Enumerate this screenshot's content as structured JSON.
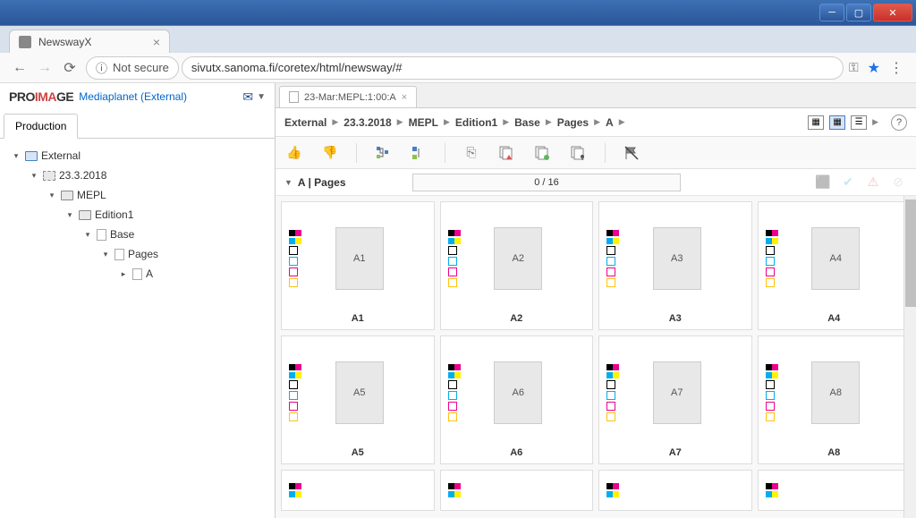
{
  "window": {
    "tab_title": "NewswayX"
  },
  "browser": {
    "not_secure_label": "Not secure",
    "url": "sivutx.sanoma.fi/coretex/html/newsway/#"
  },
  "sidebar": {
    "logo_main": "PRO",
    "logo_accent": "IMA",
    "logo_end": "GE",
    "user": "Mediaplanet (External)",
    "tab": "Production",
    "tree": {
      "root": "External",
      "date": "23.3.2018",
      "pub": "MEPL",
      "edition": "Edition1",
      "base": "Base",
      "pages": "Pages",
      "section": "A"
    }
  },
  "main": {
    "tab_label": "23-Mar:MEPL:1:00:A",
    "breadcrumb": [
      "External",
      "23.3.2018",
      "MEPL",
      "Edition1",
      "Base",
      "Pages",
      "A"
    ],
    "section_title": "A | Pages",
    "progress": "0 / 16",
    "pages": [
      {
        "id": "A1"
      },
      {
        "id": "A2"
      },
      {
        "id": "A3"
      },
      {
        "id": "A4"
      },
      {
        "id": "A5"
      },
      {
        "id": "A6"
      },
      {
        "id": "A7"
      },
      {
        "id": "A8"
      }
    ]
  }
}
